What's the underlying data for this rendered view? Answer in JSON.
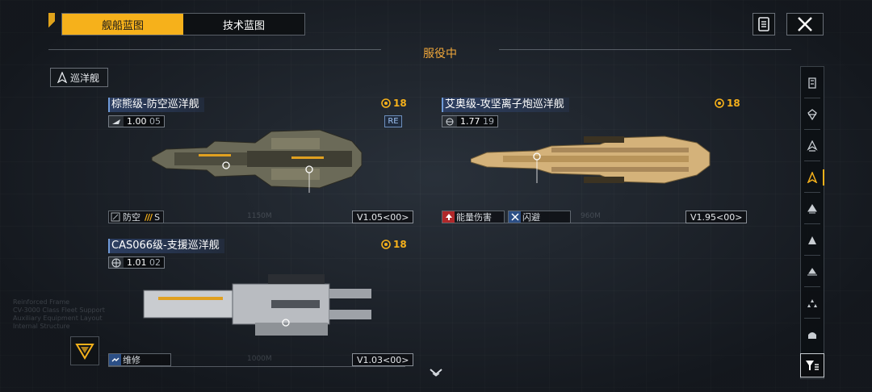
{
  "tabs": [
    {
      "label": "舰船蓝图",
      "active": true
    },
    {
      "label": "技术蓝图",
      "active": false
    }
  ],
  "status": "服役中",
  "category": {
    "label": "巡洋舰",
    "icon": "cruiser-icon"
  },
  "ships": [
    {
      "title": "棕熊级-防空巡洋舰",
      "badge": "18",
      "version_main": "1.00",
      "version_sub": "05",
      "re_label": "RE",
      "traits": [
        {
          "label": "防空",
          "icon": "anti-air-icon",
          "slashes": "///",
          "grade": "S"
        }
      ],
      "length_label": "1150M",
      "version_tag": "V1.05<00>",
      "hull_color": "#6b6a58"
    },
    {
      "title": "艾奥级-攻坚离子炮巡洋舰",
      "badge": "18",
      "version_main": "1.77",
      "version_sub": "19",
      "traits": [
        {
          "label": "能量伤害",
          "icon": "energy-damage-icon"
        },
        {
          "label": "闪避",
          "icon": "evade-icon"
        }
      ],
      "length_label": "960M",
      "version_tag": "V1.95<00>",
      "hull_color": "#d4b27a"
    },
    {
      "title": "CAS066级-支援巡洋舰",
      "badge": "18",
      "version_main": "1.01",
      "version_sub": "02",
      "traits": [
        {
          "label": "维修",
          "icon": "repair-icon"
        }
      ],
      "length_label": "1000M",
      "version_tag": "V1.03<00>",
      "hull_color": "#c9ccd0"
    }
  ],
  "rail": {
    "items": [
      {
        "icon": "carrier-icon",
        "active": false
      },
      {
        "icon": "battlecruiser-icon",
        "active": false
      },
      {
        "icon": "destroyer-icon",
        "active": false
      },
      {
        "icon": "cruiser-icon",
        "active": true
      },
      {
        "icon": "frigate-icon",
        "active": false
      },
      {
        "icon": "corvette-icon",
        "active": false
      },
      {
        "icon": "fighter-icon",
        "active": false
      },
      {
        "icon": "squadron-icon",
        "active": false
      },
      {
        "icon": "auxiliary-icon",
        "active": false
      }
    ],
    "filter_icon": "filter-icon"
  },
  "colors": {
    "accent": "#f6b11b",
    "status": "#f2a83a",
    "title_bg": "#2d3f63"
  }
}
